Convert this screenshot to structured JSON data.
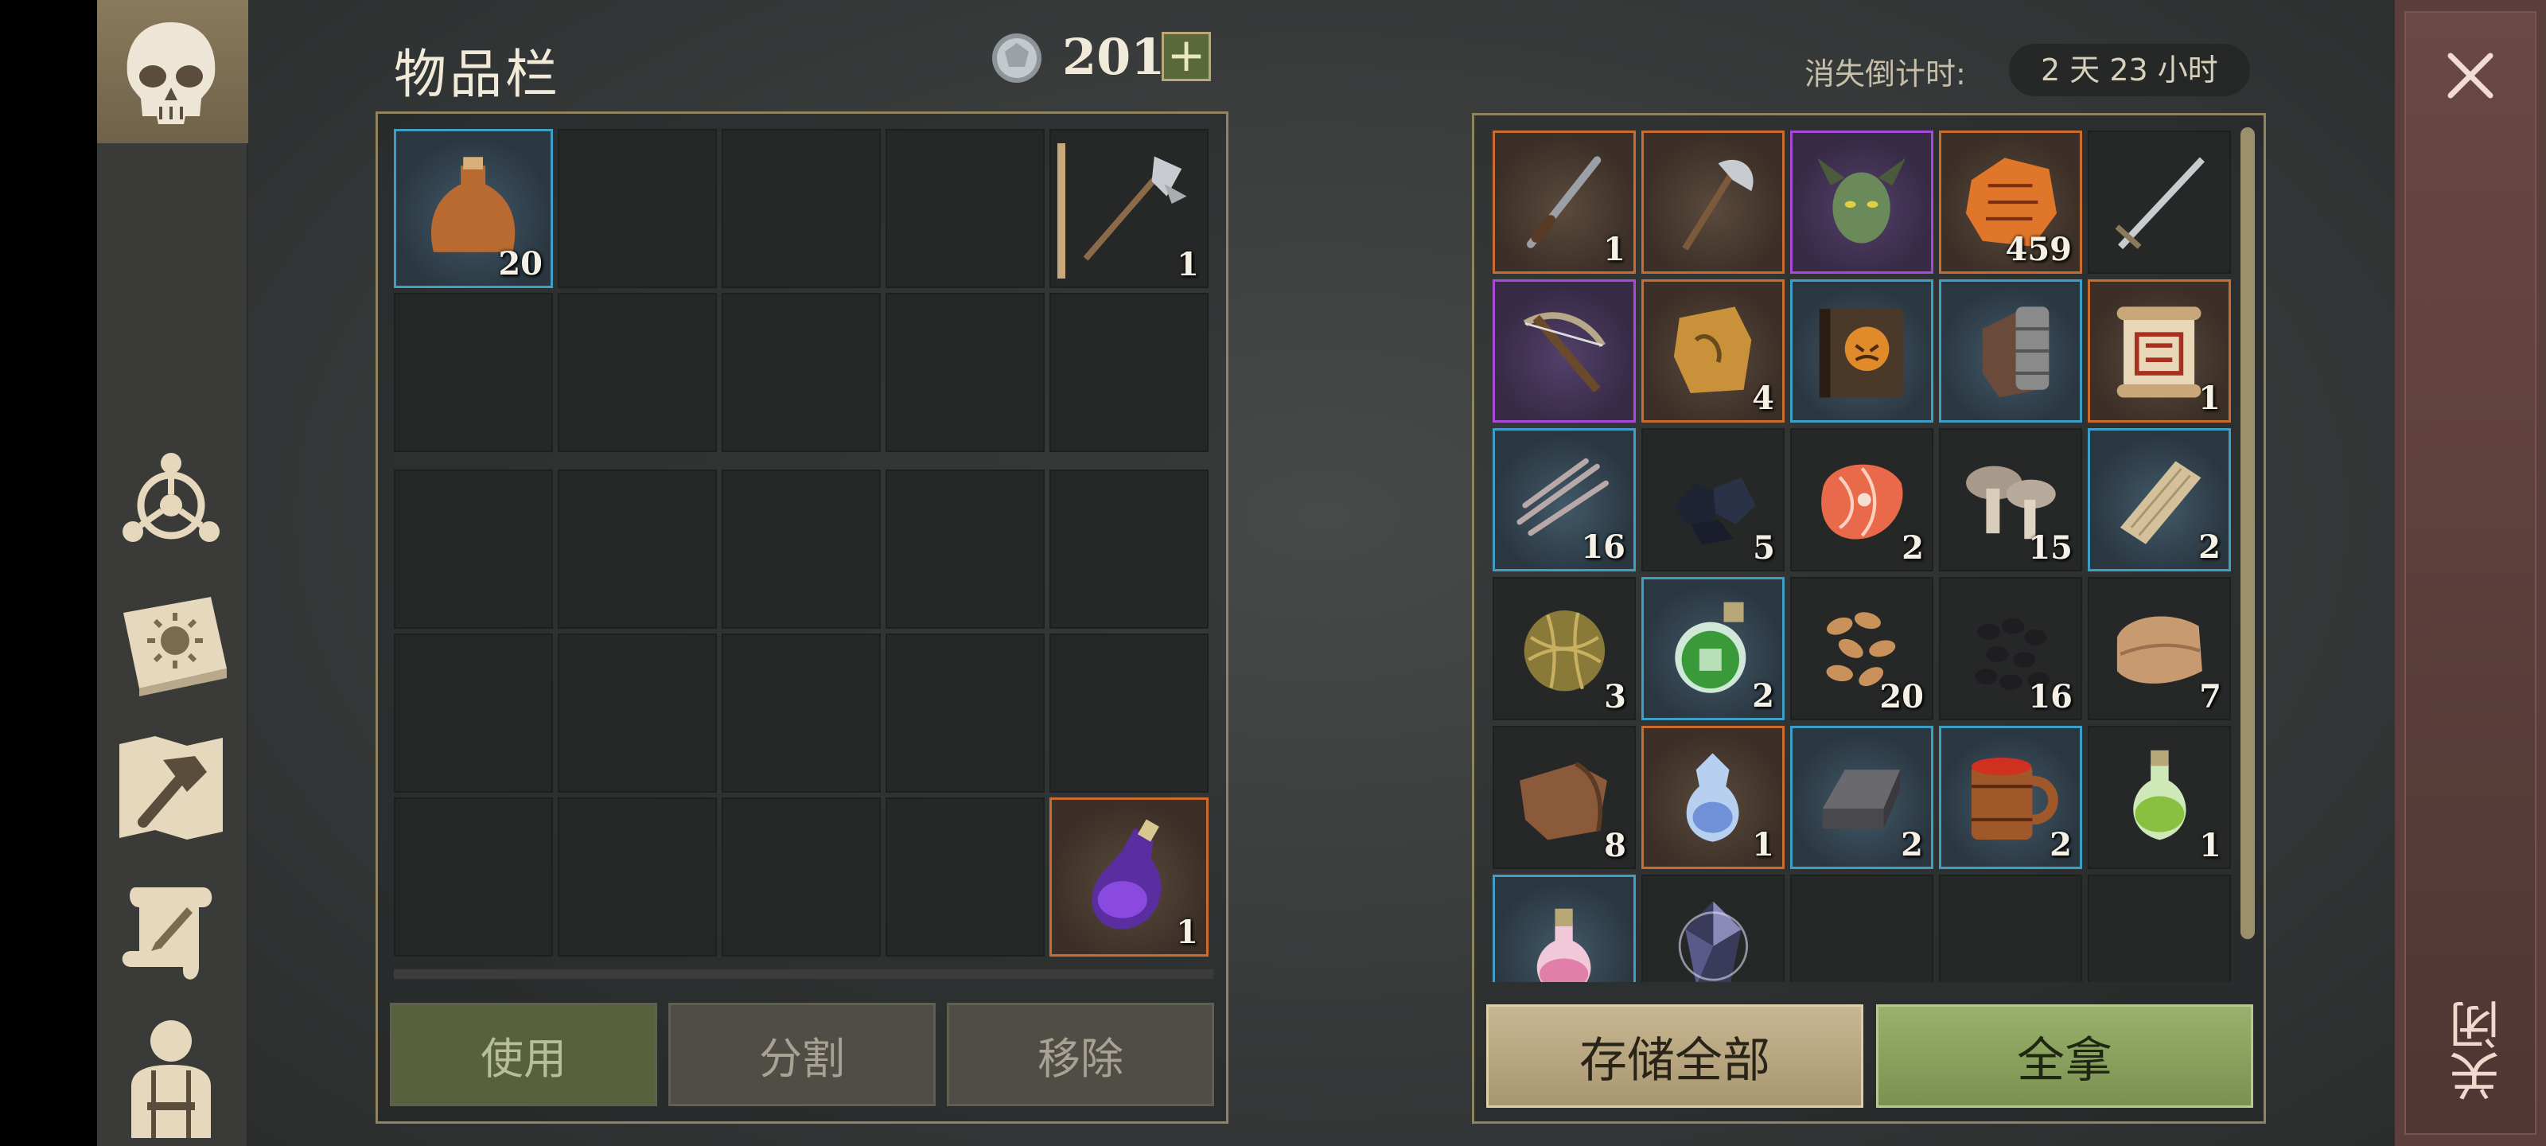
{
  "window": {
    "title": "物品栏",
    "close_label": "关闭"
  },
  "currency": {
    "value": "201",
    "add_label": "+"
  },
  "countdown": {
    "label": "消失倒计时:",
    "value": "2 天 23 小时"
  },
  "inventory": {
    "slots": [
      {
        "icon": "bottle-icon",
        "rarity": "blue",
        "count": "20"
      },
      {
        "icon": "",
        "rarity": "",
        "count": ""
      },
      {
        "icon": "",
        "rarity": "",
        "count": ""
      },
      {
        "icon": "",
        "rarity": "",
        "count": ""
      },
      {
        "icon": "halberd-icon",
        "rarity": "",
        "count": "1",
        "durability": 1.0
      },
      {
        "icon": "",
        "rarity": "",
        "count": ""
      },
      {
        "icon": "",
        "rarity": "",
        "count": ""
      },
      {
        "icon": "",
        "rarity": "",
        "count": ""
      },
      {
        "icon": "",
        "rarity": "",
        "count": ""
      },
      {
        "icon": "",
        "rarity": "",
        "count": ""
      },
      {
        "icon": "",
        "rarity": "",
        "count": ""
      },
      {
        "icon": "",
        "rarity": "",
        "count": ""
      },
      {
        "icon": "",
        "rarity": "",
        "count": ""
      },
      {
        "icon": "",
        "rarity": "",
        "count": ""
      },
      {
        "icon": "",
        "rarity": "",
        "count": ""
      },
      {
        "icon": "",
        "rarity": "",
        "count": ""
      },
      {
        "icon": "",
        "rarity": "",
        "count": ""
      },
      {
        "icon": "",
        "rarity": "",
        "count": ""
      },
      {
        "icon": "",
        "rarity": "",
        "count": ""
      },
      {
        "icon": "",
        "rarity": "",
        "count": ""
      },
      {
        "icon": "",
        "rarity": "",
        "count": ""
      },
      {
        "icon": "",
        "rarity": "",
        "count": ""
      },
      {
        "icon": "",
        "rarity": "",
        "count": ""
      },
      {
        "icon": "",
        "rarity": "",
        "count": ""
      },
      {
        "icon": "purple-potion-icon",
        "rarity": "orange",
        "count": "1"
      }
    ]
  },
  "stash": {
    "slots": [
      {
        "icon": "dagger-icon",
        "rarity": "orange",
        "count": "1"
      },
      {
        "icon": "axe-icon",
        "rarity": "orange",
        "count": ""
      },
      {
        "icon": "demon-head-icon",
        "rarity": "purple",
        "count": ""
      },
      {
        "icon": "rune-fragment-icon",
        "rarity": "orange",
        "count": "459"
      },
      {
        "icon": "sword-icon",
        "rarity": "",
        "count": ""
      },
      {
        "icon": "crossbow-icon",
        "rarity": "purple",
        "count": ""
      },
      {
        "icon": "map-fragment-icon",
        "rarity": "orange",
        "count": "4"
      },
      {
        "icon": "tome-icon",
        "rarity": "blue",
        "count": ""
      },
      {
        "icon": "gauntlet-icon",
        "rarity": "blue",
        "count": ""
      },
      {
        "icon": "scroll-icon",
        "rarity": "orange",
        "count": "1"
      },
      {
        "icon": "claw-icon",
        "rarity": "blue",
        "count": "16"
      },
      {
        "icon": "coal-icon",
        "rarity": "",
        "count": "5"
      },
      {
        "icon": "fish-steak-icon",
        "rarity": "",
        "count": "2"
      },
      {
        "icon": "mushroom-icon",
        "rarity": "",
        "count": "15"
      },
      {
        "icon": "plank-icon",
        "rarity": "blue",
        "count": "2"
      },
      {
        "icon": "fiber-ball-icon",
        "rarity": "",
        "count": "3"
      },
      {
        "icon": "green-flask-icon",
        "rarity": "blue",
        "count": "2"
      },
      {
        "icon": "seeds-icon",
        "rarity": "",
        "count": "20"
      },
      {
        "icon": "black-seeds-icon",
        "rarity": "",
        "count": "16"
      },
      {
        "icon": "cloth-icon",
        "rarity": "",
        "count": "7"
      },
      {
        "icon": "leather-icon",
        "rarity": "",
        "count": "8"
      },
      {
        "icon": "crystal-flask-icon",
        "rarity": "orange",
        "count": "1"
      },
      {
        "icon": "iron-ingot-icon",
        "rarity": "blue",
        "count": "2"
      },
      {
        "icon": "mug-icon",
        "rarity": "blue",
        "count": "2"
      },
      {
        "icon": "lime-potion-icon",
        "rarity": "",
        "count": "1"
      },
      {
        "icon": "pink-potion-icon",
        "rarity": "blue",
        "count": ""
      },
      {
        "icon": "gem-shard-icon",
        "rarity": "",
        "count": ""
      },
      {
        "icon": "",
        "rarity": "",
        "count": ""
      },
      {
        "icon": "",
        "rarity": "",
        "count": ""
      },
      {
        "icon": "",
        "rarity": "",
        "count": ""
      }
    ]
  },
  "buttons": {
    "use": "使用",
    "split": "分割",
    "remove": "移除",
    "store_all": "存储全部",
    "take_all": "全拿"
  },
  "sidebar": {
    "items": [
      {
        "icon": "skull-icon"
      },
      {
        "icon": "tech-wheel-icon"
      },
      {
        "icon": "sun-book-icon"
      },
      {
        "icon": "hammer-map-icon"
      },
      {
        "icon": "quest-scroll-icon"
      },
      {
        "icon": "character-icon"
      }
    ]
  },
  "colors": {
    "rarity_orange": "#c86d2e",
    "rarity_blue": "#3e9ec6",
    "rarity_purple": "#a84ad8",
    "accent_green": "#7a9150",
    "accent_tan": "#a89670"
  }
}
